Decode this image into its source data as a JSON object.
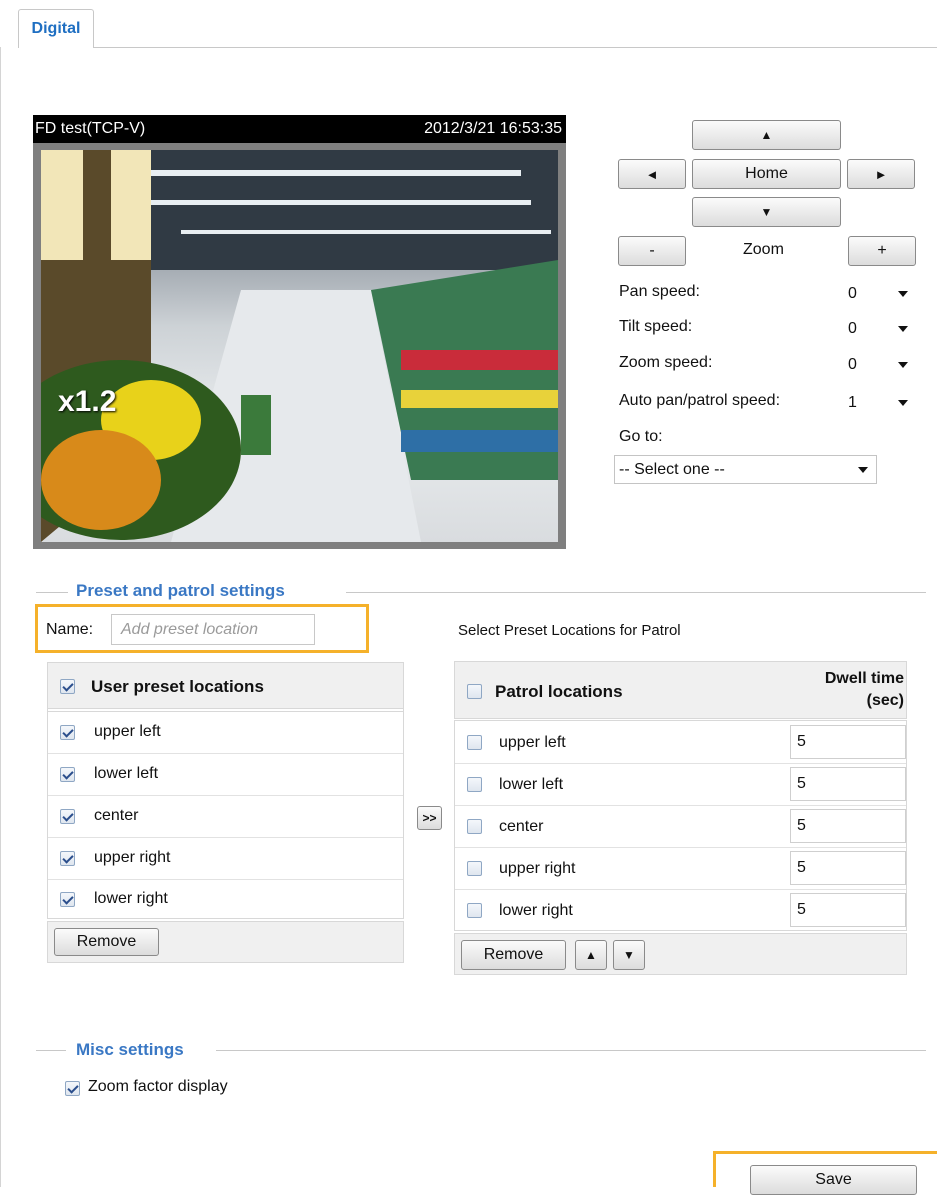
{
  "tab": {
    "label": "Digital"
  },
  "video": {
    "name": "FD test(TCP-V)",
    "timestamp": "2012/3/21 16:53:35",
    "zoom_factor": "x1.2"
  },
  "ptz": {
    "up_symbol": "▲",
    "down_symbol": "▼",
    "left_symbol": "◄",
    "right_symbol": "►",
    "home_label": "Home",
    "zoom_out_label": "-",
    "zoom_in_label": "+",
    "zoom_label": "Zoom",
    "speeds": [
      {
        "label": "Pan speed:",
        "value": "0"
      },
      {
        "label": "Tilt speed:",
        "value": "0"
      },
      {
        "label": "Zoom speed:",
        "value": "0"
      },
      {
        "label": "Auto pan/patrol speed:",
        "value": "1"
      }
    ],
    "goto_label": "Go to:",
    "goto_value": "-- Select one --"
  },
  "preset": {
    "section_title": "Preset and patrol settings",
    "name_label": "Name:",
    "name_placeholder": "Add preset location",
    "select_label": "Select Preset Locations for Patrol",
    "user_header": "User preset locations",
    "user_items": [
      "upper left",
      "lower left",
      "center",
      "upper right",
      "lower right"
    ],
    "remove_label": "Remove",
    "add_label": ">>",
    "patrol_header": "Patrol locations",
    "dwell_header_line1": "Dwell time",
    "dwell_header_line2": "(sec)",
    "patrol_items": [
      {
        "name": "upper left",
        "dwell": "5"
      },
      {
        "name": "lower left",
        "dwell": "5"
      },
      {
        "name": "center",
        "dwell": "5"
      },
      {
        "name": "upper right",
        "dwell": "5"
      },
      {
        "name": "lower right",
        "dwell": "5"
      }
    ],
    "patrol_remove_label": "Remove",
    "move_up_symbol": "▲",
    "move_down_symbol": "▼"
  },
  "misc": {
    "section_title": "Misc settings",
    "zoom_display_label": "Zoom factor display"
  },
  "save_label": "Save",
  "colors": {
    "accent": "#3a78c4",
    "highlight": "#f5b12a",
    "tab_text": "#1f6fc2"
  }
}
